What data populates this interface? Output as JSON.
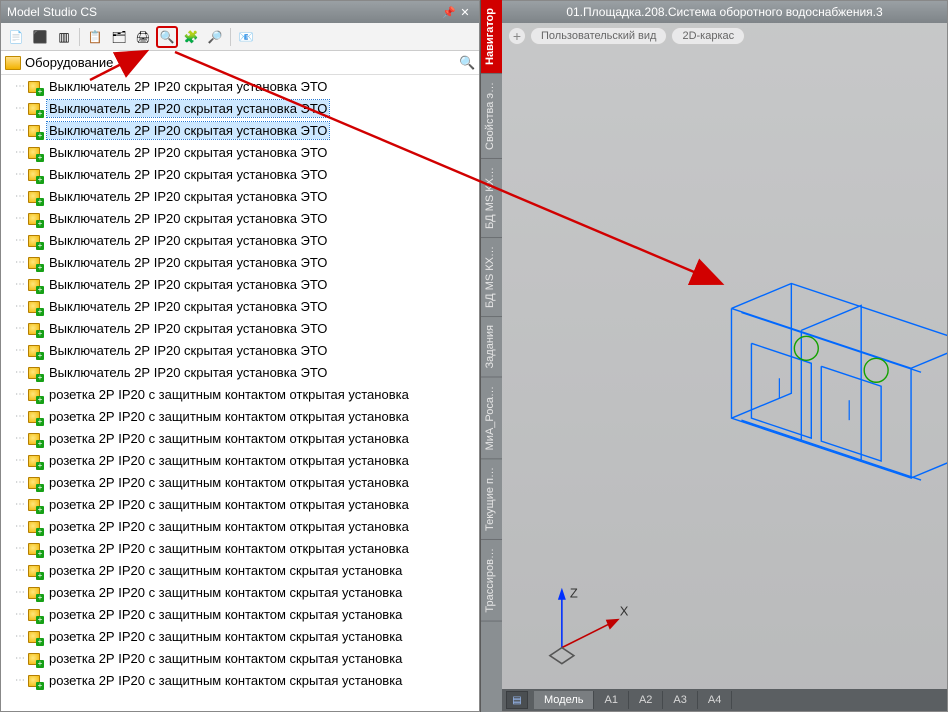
{
  "panel": {
    "title": "Model Studio CS"
  },
  "filter": {
    "value": "Оборудование"
  },
  "tree": {
    "items": [
      {
        "label": "Выключатель 2Р IP20 скрытая установка  ЭТО",
        "sel": false
      },
      {
        "label": "Выключатель 2Р IP20 скрытая установка  ЭТО",
        "sel": true
      },
      {
        "label": "Выключатель 2Р IP20 скрытая установка  ЭТО",
        "sel": true
      },
      {
        "label": "Выключатель 2Р IP20 скрытая установка  ЭТО",
        "sel": false
      },
      {
        "label": "Выключатель 2Р IP20 скрытая установка  ЭТО",
        "sel": false
      },
      {
        "label": "Выключатель 2Р IP20 скрытая установка  ЭТО",
        "sel": false
      },
      {
        "label": "Выключатель 2Р IP20 скрытая установка  ЭТО",
        "sel": false
      },
      {
        "label": "Выключатель 2Р IP20 скрытая установка  ЭТО",
        "sel": false
      },
      {
        "label": "Выключатель 2Р IP20 скрытая установка  ЭТО",
        "sel": false
      },
      {
        "label": "Выключатель 2Р IP20 скрытая установка  ЭТО",
        "sel": false
      },
      {
        "label": "Выключатель 2Р IP20 скрытая установка  ЭТО",
        "sel": false
      },
      {
        "label": "Выключатель 2Р IP20 скрытая установка  ЭТО",
        "sel": false
      },
      {
        "label": "Выключатель 2Р IP20 скрытая установка  ЭТО",
        "sel": false
      },
      {
        "label": "Выключатель 2Р IP20 скрытая установка  ЭТО",
        "sel": false
      },
      {
        "label": "розетка 2Р IP20 с защитным контактом  открытая установка  ",
        "sel": false
      },
      {
        "label": "розетка 2Р IP20 с защитным контактом  открытая установка  ",
        "sel": false
      },
      {
        "label": "розетка 2Р IP20 с защитным контактом  открытая установка  ",
        "sel": false
      },
      {
        "label": "розетка 2Р IP20 с защитным контактом  открытая установка  ",
        "sel": false
      },
      {
        "label": "розетка 2Р IP20 с защитным контактом  открытая установка  ",
        "sel": false
      },
      {
        "label": "розетка 2Р IP20 с защитным контактом  открытая установка  ",
        "sel": false
      },
      {
        "label": "розетка 2Р IP20 с защитным контактом  открытая установка  ",
        "sel": false
      },
      {
        "label": "розетка 2Р IP20 с защитным контактом  открытая установка  ",
        "sel": false
      },
      {
        "label": "розетка 2Р IP20 с защитным контактом скрытая установка  ",
        "sel": false
      },
      {
        "label": "розетка 2Р IP20 с защитным контактом скрытая установка  ",
        "sel": false
      },
      {
        "label": "розетка 2Р IP20 с защитным контактом скрытая установка  ",
        "sel": false
      },
      {
        "label": "розетка 2Р IP20 с защитным контактом скрытая установка  ",
        "sel": false
      },
      {
        "label": "розетка 2Р IP20 с защитным контактом скрытая установка  ",
        "sel": false
      },
      {
        "label": "розетка 2Р IP20 с защитным контактом скрытая установка  ",
        "sel": false
      }
    ]
  },
  "vtabs": [
    {
      "label": "Навигатор",
      "active": true
    },
    {
      "label": "Свойства э…",
      "active": false
    },
    {
      "label": "БД MS КХ…",
      "active": false
    },
    {
      "label": "БД MS КХ…",
      "active": false
    },
    {
      "label": "Задания",
      "active": false
    },
    {
      "label": "МиА_Роса…",
      "active": false
    },
    {
      "label": "Текущие п…",
      "active": false
    },
    {
      "label": "Трассиров…",
      "active": false
    }
  ],
  "viewport": {
    "title": "01.Площадка.208.Система оборотного водоснабжения.3",
    "crumbs": [
      "Пользовательский вид",
      "2D-каркас"
    ],
    "axes": {
      "x": "X",
      "z": "Z"
    },
    "tabs": {
      "active": "Модель",
      "others": [
        "А1",
        "А2",
        "А3",
        "А4"
      ]
    }
  },
  "icons": {
    "tb": [
      "📄",
      "⬛",
      "▥",
      "📋",
      "🗂",
      "🖨",
      "🔍",
      "🧩",
      "🔎",
      "📧"
    ]
  }
}
